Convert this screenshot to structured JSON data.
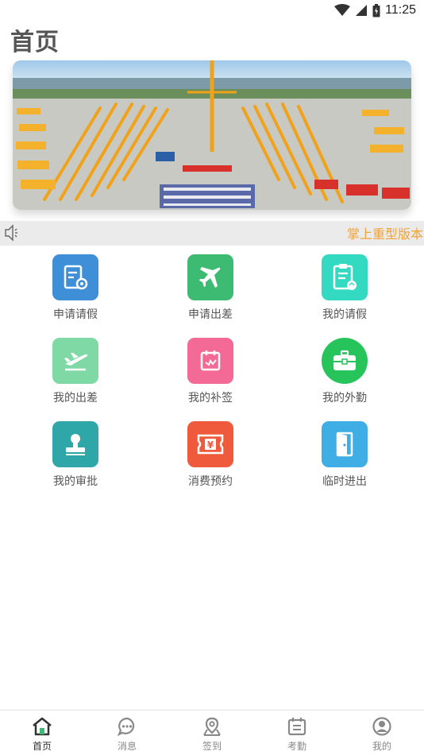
{
  "status_bar": {
    "time": "11:25"
  },
  "header": {
    "title": "首页"
  },
  "banner": {
    "image": "banner-photo-crane-fleet"
  },
  "notice": {
    "text": "掌上重型版本"
  },
  "grid": {
    "items": [
      {
        "label": "申请请假",
        "icon": "leave-request-icon",
        "color": "#3f8fd8"
      },
      {
        "label": "申请出差",
        "icon": "airplane-icon",
        "color": "#3dbb73"
      },
      {
        "label": "我的请假",
        "icon": "clipboard-icon",
        "color": "#33d9c0"
      },
      {
        "label": "我的出差",
        "icon": "takeoff-icon",
        "color": "#7fd9a5"
      },
      {
        "label": "我的补签",
        "icon": "calendar-icon",
        "color": "#f46a97"
      },
      {
        "label": "我的外勤",
        "icon": "briefcase-icon",
        "color": "#27c45c"
      },
      {
        "label": "我的审批",
        "icon": "stamp-icon",
        "color": "#2fa7a9"
      },
      {
        "label": "消费预约",
        "icon": "ticket-icon",
        "color": "#ef5a3d"
      },
      {
        "label": "临时进出",
        "icon": "door-icon",
        "color": "#3eaee4"
      }
    ]
  },
  "tabbar": {
    "items": [
      {
        "label": "首页",
        "icon": "home-icon",
        "active": true
      },
      {
        "label": "消息",
        "icon": "chat-icon",
        "active": false
      },
      {
        "label": "签到",
        "icon": "location-icon",
        "active": false
      },
      {
        "label": "考勤",
        "icon": "attendance-icon",
        "active": false
      },
      {
        "label": "我的",
        "icon": "profile-icon",
        "active": false
      }
    ]
  }
}
